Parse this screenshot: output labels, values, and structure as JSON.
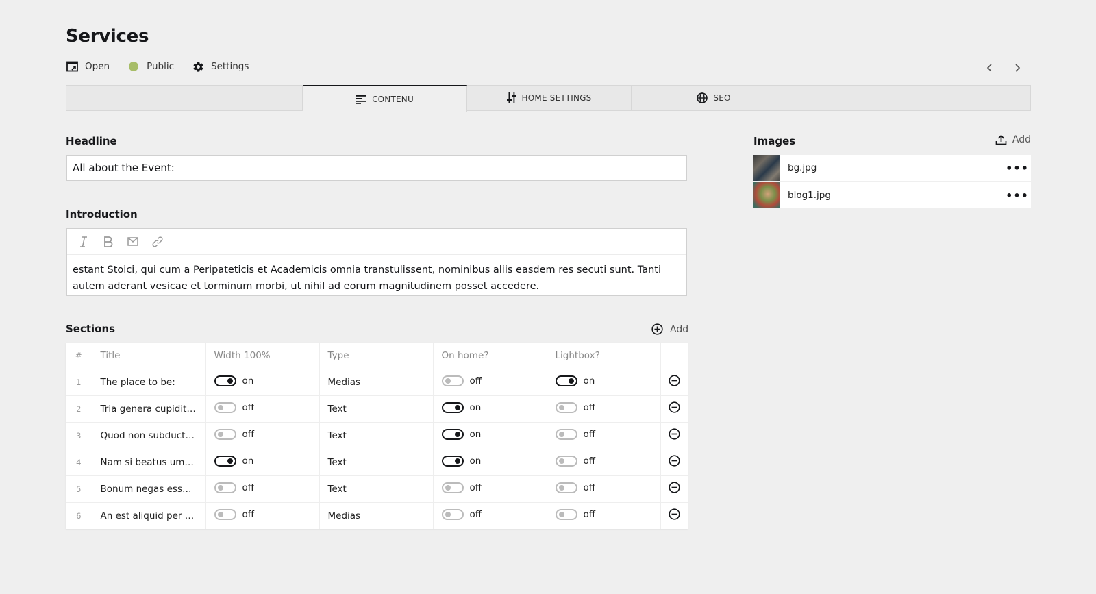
{
  "header": {
    "title": "Services",
    "open_label": "Open",
    "status_label": "Public",
    "status_color": "#a7bd68",
    "settings_label": "Settings"
  },
  "tabs": [
    {
      "label": "CONTENU",
      "icon": "text-align-icon",
      "active": true
    },
    {
      "label": "HOME SETTINGS",
      "icon": "sliders-icon",
      "active": false
    },
    {
      "label": "SEO",
      "icon": "globe-icon",
      "active": false
    }
  ],
  "headline": {
    "label": "Headline",
    "value": "All about the Event:"
  },
  "introduction": {
    "label": "Introduction",
    "toolbar": [
      "italic-icon",
      "bold-icon",
      "email-icon",
      "link-icon"
    ],
    "text": "estant Stoici, qui cum a Peripateticis et Academicis omnia transtulissent, nominibus aliis easdem res secuti sunt. Tanti autem aderant vesicae et torminum morbi, ut nihil ad eorum magnitudinem posset accedere."
  },
  "sections": {
    "label": "Sections",
    "add_label": "Add",
    "columns": [
      "#",
      "Title",
      "Width 100%",
      "Type",
      "On home?",
      "Lightbox?"
    ],
    "rows": [
      {
        "num": "1",
        "title": "The place to be:",
        "width": "on",
        "type": "Medias",
        "home": "off",
        "lightbox": "on"
      },
      {
        "num": "2",
        "title": "Tria genera cupiditat...",
        "width": "off",
        "type": "Text",
        "home": "on",
        "lightbox": "off"
      },
      {
        "num": "3",
        "title": "Quod non subducta ...",
        "width": "off",
        "type": "Text",
        "home": "on",
        "lightbox": "off"
      },
      {
        "num": "4",
        "title": "Nam si beatus umqu...",
        "width": "on",
        "type": "Text",
        "home": "on",
        "lightbox": "off"
      },
      {
        "num": "5",
        "title": "Bonum negas esse di...",
        "width": "off",
        "type": "Text",
        "home": "off",
        "lightbox": "off"
      },
      {
        "num": "6",
        "title": "An est aliquid per se i...",
        "width": "off",
        "type": "Medias",
        "home": "off",
        "lightbox": "off"
      }
    ]
  },
  "images": {
    "label": "Images",
    "add_label": "Add",
    "items": [
      {
        "name": "bg.jpg"
      },
      {
        "name": "blog1.jpg"
      }
    ]
  }
}
